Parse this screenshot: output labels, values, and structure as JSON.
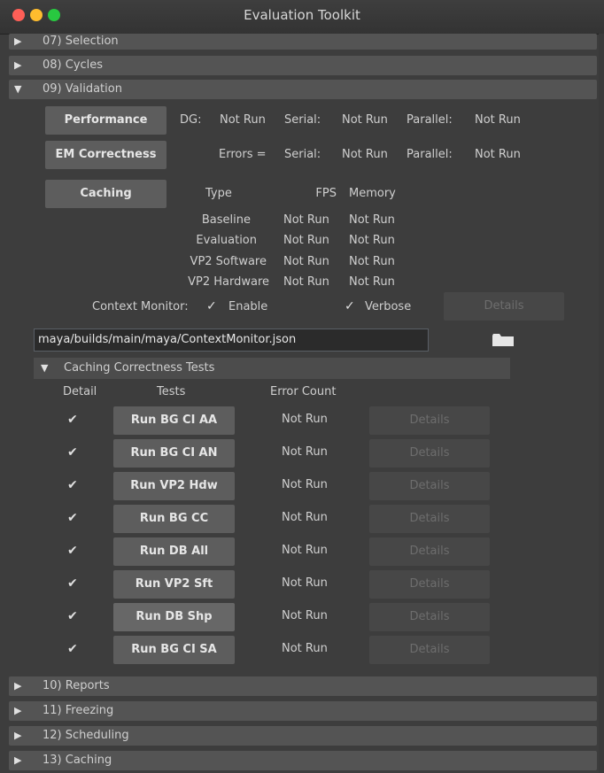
{
  "window": {
    "title": "Evaluation Toolkit"
  },
  "sections_top": [
    {
      "label": "07) Selection",
      "expanded": false
    },
    {
      "label": "08) Cycles",
      "expanded": false
    },
    {
      "label": "09) Validation",
      "expanded": true
    }
  ],
  "validation": {
    "performance_button": "Performance",
    "dg_label": "DG:",
    "dg_value": "Not Run",
    "serial_label": "Serial:",
    "serial_value": "Not Run",
    "parallel_label": "Parallel:",
    "parallel_value": "Not Run",
    "em_button": "EM Correctness",
    "errors_label": "Errors =",
    "em_serial_label": "Serial:",
    "em_serial_value": "Not Run",
    "em_parallel_label": "Parallel:",
    "em_parallel_value": "Not Run",
    "caching_button": "Caching",
    "caching_headers": {
      "type": "Type",
      "fps": "FPS",
      "memory": "Memory"
    },
    "caching_rows": [
      {
        "type": "Baseline",
        "fps": "Not Run",
        "memory": "Not Run"
      },
      {
        "type": "Evaluation",
        "fps": "Not Run",
        "memory": "Not Run"
      },
      {
        "type": "VP2 Software",
        "fps": "Not Run",
        "memory": "Not Run"
      },
      {
        "type": "VP2 Hardware",
        "fps": "Not Run",
        "memory": "Not Run"
      }
    ],
    "context_monitor_label": "Context Monitor:",
    "enable_label": "Enable",
    "enable_checked": true,
    "verbose_label": "Verbose",
    "verbose_checked": true,
    "details_label": "Details",
    "path_value": "maya/builds/main/maya/ContextMonitor.json",
    "check_glyph": "✓"
  },
  "caching_tests": {
    "title": "Caching Correctness Tests",
    "headers": {
      "detail": "Detail",
      "tests": "Tests",
      "error_count": "Error Count"
    },
    "rows": [
      {
        "detail": true,
        "test": "Run BG CI AA",
        "error": "Not Run",
        "details": "Details"
      },
      {
        "detail": true,
        "test": "Run BG CI AN",
        "error": "Not Run",
        "details": "Details"
      },
      {
        "detail": true,
        "test": "Run VP2 Hdw",
        "error": "Not Run",
        "details": "Details"
      },
      {
        "detail": true,
        "test": "Run BG CC",
        "error": "Not Run",
        "details": "Details"
      },
      {
        "detail": true,
        "test": "Run DB All",
        "error": "Not Run",
        "details": "Details"
      },
      {
        "detail": true,
        "test": "Run VP2 Sft",
        "error": "Not Run",
        "details": "Details"
      },
      {
        "detail": true,
        "test": "Run DB Shp",
        "error": "Not Run",
        "details": "Details"
      },
      {
        "detail": true,
        "test": "Run BG CI SA",
        "error": "Not Run",
        "details": "Details"
      }
    ],
    "check_glyph": "✔"
  },
  "sections_bottom": [
    {
      "label": "10) Reports",
      "expanded": false
    },
    {
      "label": "11) Freezing",
      "expanded": false
    },
    {
      "label": "12) Scheduling",
      "expanded": false
    },
    {
      "label": "13) Caching",
      "expanded": false
    }
  ],
  "icons": {
    "collapsed": "▶",
    "expanded": "▼"
  }
}
